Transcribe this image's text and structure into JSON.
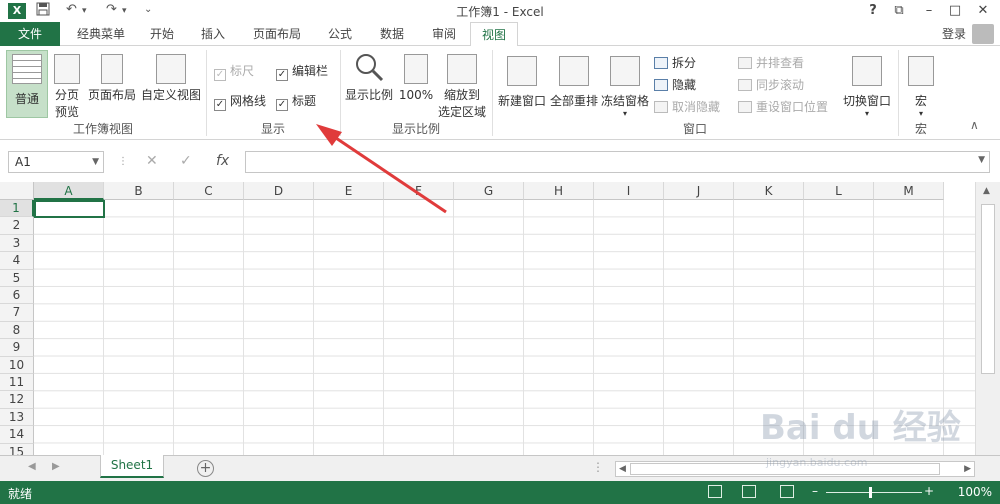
{
  "window": {
    "title": "工作簿1 - Excel",
    "help": "?",
    "restore_ribbon": "⧉",
    "minimize": "–",
    "maximize": "□",
    "close": "✕"
  },
  "quick_access": {
    "logo": "X",
    "save_icon": "save-icon",
    "undo": "↶",
    "redo": "↷",
    "customize": "⌄"
  },
  "tabs": [
    {
      "label": "文件"
    },
    {
      "label": "经典菜单"
    },
    {
      "label": "开始"
    },
    {
      "label": "插入"
    },
    {
      "label": "页面布局"
    },
    {
      "label": "公式"
    },
    {
      "label": "数据"
    },
    {
      "label": "审阅"
    },
    {
      "label": "视图"
    }
  ],
  "account": {
    "login": "登录"
  },
  "ribbon": {
    "workbook_views": {
      "label": "工作簿视图",
      "normal": "普通",
      "page_break_1": "分页",
      "page_break_2": "预览",
      "page_layout": "页面布局",
      "custom_views": "自定义视图"
    },
    "show": {
      "label": "显示",
      "ruler": "标尺",
      "formula_bar": "编辑栏",
      "gridlines": "网格线",
      "headings": "标题",
      "ruler_checked": "✓",
      "formula_bar_checked": "✓",
      "gridlines_checked": "✓",
      "headings_checked": "✓"
    },
    "zoom": {
      "label": "显示比例",
      "zoom": "显示比例",
      "hundred": "100%",
      "zoom_sel_1": "缩放到",
      "zoom_sel_2": "选定区域"
    },
    "window": {
      "label": "窗口",
      "new_window": "新建窗口",
      "arrange_all": "全部重排",
      "freeze_panes": "冻结窗格",
      "split": "拆分",
      "hide": "隐藏",
      "unhide": "取消隐藏",
      "side_by_side": "并排查看",
      "sync_scroll": "同步滚动",
      "reset_position": "重设窗口位置",
      "switch_windows": "切换窗口"
    },
    "macros": {
      "label": "宏",
      "macros": "宏"
    },
    "collapse": "∧"
  },
  "formula_bar": {
    "name_box": "A1",
    "cancel": "✕",
    "enter": "✓",
    "fx": "fx",
    "value": ""
  },
  "grid": {
    "columns": [
      "A",
      "B",
      "C",
      "D",
      "E",
      "F",
      "G",
      "H",
      "I",
      "J",
      "K",
      "L",
      "M"
    ],
    "rows": [
      "1",
      "2",
      "3",
      "4",
      "5",
      "6",
      "7",
      "8",
      "9",
      "10",
      "11",
      "12",
      "13",
      "14",
      "15"
    ]
  },
  "sheets": {
    "tabs": [
      "Sheet1"
    ],
    "add": "+"
  },
  "status": {
    "text": "就绪",
    "zoom": "100%",
    "zoom_minus": "–",
    "zoom_plus": "+"
  },
  "watermark": {
    "brand": "Bai du 经验",
    "url": "jingyan.baidu.com"
  },
  "colors": {
    "accent": "#217346",
    "arrow": "#e03b3b"
  }
}
